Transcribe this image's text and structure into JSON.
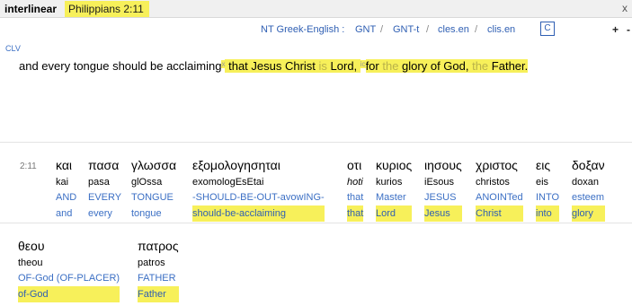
{
  "titlebar": {
    "app": "interlinear",
    "reference": "Philippians 2:11",
    "close": "x"
  },
  "toolbar": {
    "module_group": "NT Greek-English :",
    "gnt": "GNT",
    "slash": "/",
    "gnt_t": "GNT-t",
    "cles": "cles.en",
    "clis": "clis.en",
    "c_button": "C",
    "plus": "+",
    "minus": "-"
  },
  "version_label": "CLV",
  "verse": {
    "plain": "and every tongue should be acclaiming",
    "mark1": "x",
    "hl1": " that Jesus Christ ",
    "is": "is",
    "hl2": " Lord, ",
    "mark2": "ic",
    "hl3": "for ",
    "the1": "the",
    "hl4": " glory of God, ",
    "the2": "the",
    "hl5": " Father."
  },
  "verse_number": "2:11",
  "words": [
    {
      "greek": "και",
      "translit": "kai",
      "gloss": "AND",
      "english": "and",
      "english_highlight": false,
      "italic": false
    },
    {
      "greek": "πασα",
      "translit": "pasa",
      "gloss": "EVERY",
      "english": "every",
      "english_highlight": false,
      "italic": false
    },
    {
      "greek": "γλωσσα",
      "translit": "glOssa",
      "gloss": "TONGUE",
      "english": "tongue",
      "english_highlight": false,
      "italic": false
    },
    {
      "greek": "εξομολογησηται",
      "translit": "exomologEsEtai",
      "gloss": "-SHOULD-BE-OUT-avowING-",
      "english": "should-be-acclaiming",
      "english_highlight": true,
      "italic": false
    },
    {
      "greek": "οτι",
      "translit": "hoti",
      "gloss": "that",
      "english": "that",
      "english_highlight": true,
      "italic": true
    },
    {
      "greek": "κυριος",
      "translit": "kurios",
      "gloss": "Master",
      "english": "Lord",
      "english_highlight": true,
      "italic": false
    },
    {
      "greek": "ιησους",
      "translit": "iEsous",
      "gloss": "JESUS",
      "english": "Jesus",
      "english_highlight": true,
      "italic": false
    },
    {
      "greek": "χριστος",
      "translit": "christos",
      "gloss": "ANOINTed",
      "english": "Christ",
      "english_highlight": true,
      "italic": false
    },
    {
      "greek": "εις",
      "translit": "eis",
      "gloss": "INTO",
      "english": "into",
      "english_highlight": true,
      "italic": false
    },
    {
      "greek": "δοξαν",
      "translit": "doxan",
      "gloss": "esteem",
      "english": "glory",
      "english_highlight": true,
      "italic": false
    },
    {
      "greek": "θεου",
      "translit": "theou",
      "gloss": "OF-God (OF-PLACER)",
      "english": "of-God",
      "english_highlight": true,
      "italic": false
    },
    {
      "greek": "πατρος",
      "translit": "patros",
      "gloss": "FATHER",
      "english": "Father",
      "english_highlight": true,
      "italic": false
    }
  ]
}
